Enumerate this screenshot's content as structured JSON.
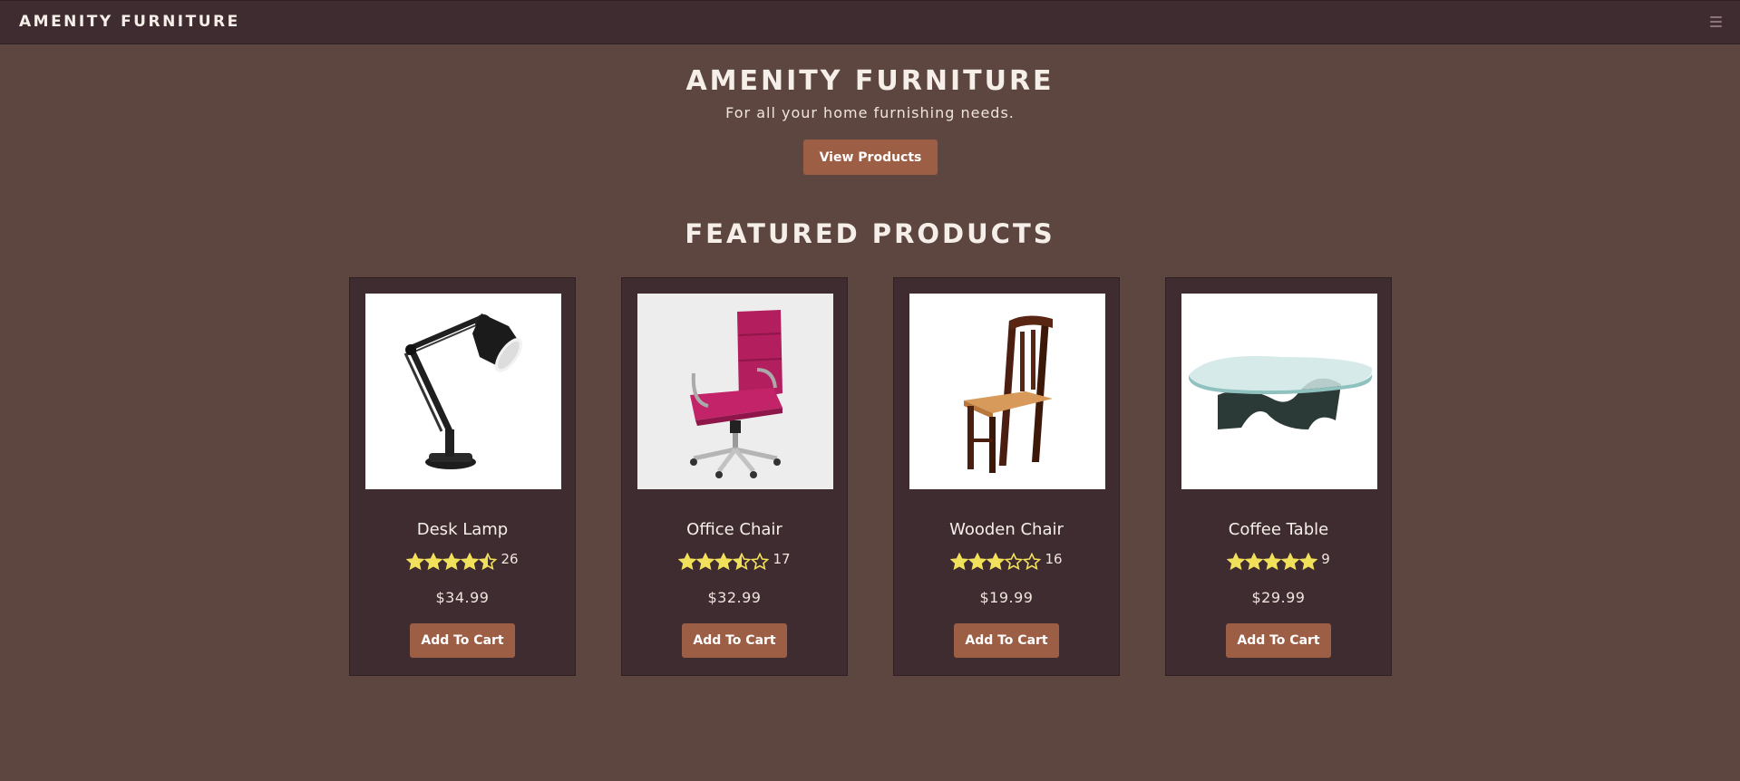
{
  "header": {
    "brand": "AMENITY FURNITURE",
    "menu_icon": "hamburger-menu-icon"
  },
  "hero": {
    "title": "AMENITY FURNITURE",
    "subtitle": "For all your home furnishing needs.",
    "button_label": "View Products"
  },
  "featured": {
    "title": "FEATURED PRODUCTS",
    "products": [
      {
        "name": "Desk Lamp",
        "rating": 4.5,
        "reviews": "26",
        "price": "$34.99",
        "button_label": "Add To Cart",
        "image_icon": "desk-lamp-image"
      },
      {
        "name": "Office Chair",
        "rating": 3.5,
        "reviews": "17",
        "price": "$32.99",
        "button_label": "Add To Cart",
        "image_icon": "office-chair-image"
      },
      {
        "name": "Wooden Chair",
        "rating": 3,
        "reviews": "16",
        "price": "$19.99",
        "button_label": "Add To Cart",
        "image_icon": "wooden-chair-image"
      },
      {
        "name": "Coffee Table",
        "rating": 5,
        "reviews": "9",
        "price": "$29.99",
        "button_label": "Add To Cart",
        "image_icon": "coffee-table-image"
      }
    ]
  },
  "colors": {
    "background": "#5d4640",
    "panel": "#3f2c30",
    "accent": "#9c5e45",
    "star": "#f1e05a"
  }
}
